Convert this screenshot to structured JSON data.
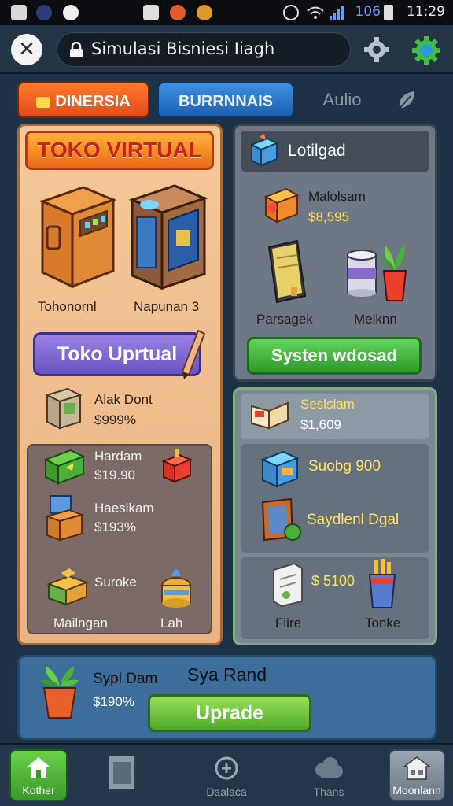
{
  "status_bar": {
    "signal_text": "106",
    "time": "11:29"
  },
  "browser": {
    "url_text": "Simulasi Bisniesi Iiagh"
  },
  "tabs": [
    {
      "label": "DINERSIA"
    },
    {
      "label": "BURRNNAIS"
    },
    {
      "label": "Aulio"
    }
  ],
  "left_panel": {
    "title": "TOKO VIRTUAL",
    "items_top": [
      {
        "label": "Tohonornl"
      },
      {
        "label": "Napunan 3"
      }
    ],
    "primary_button": "Toko Uprtual",
    "featured": {
      "name": "Alak Dont",
      "price": "$999%"
    },
    "list": [
      {
        "name": "Hardam",
        "price": "$19.90"
      },
      {
        "name": "Haeslkam",
        "price": "$193%"
      }
    ],
    "bottom_items": [
      {
        "name": "Suroke",
        "label": "Mailngan"
      },
      {
        "label": "Lah"
      }
    ]
  },
  "right_top": {
    "header": "Lotilgad",
    "item": {
      "name": "Malolsam",
      "price": "$8,595"
    },
    "items": [
      {
        "label": "Parsagek"
      },
      {
        "label": "Melknn"
      }
    ],
    "button": "Systen wdosad"
  },
  "right_bottom": {
    "header": {
      "name": "Seslslam",
      "price": "$1,609"
    },
    "rows": [
      {
        "label": "Suobg 900"
      },
      {
        "label": "Saydlenl Dgal"
      }
    ],
    "items": [
      {
        "price": "$ 5100",
        "label": "Flire"
      },
      {
        "label": "Tonke"
      }
    ]
  },
  "bottom_panel": {
    "item_name": "Sypl Dam",
    "item_price": "$190%",
    "title": "Sya Rand",
    "button": "Uprade"
  },
  "bottom_nav": [
    {
      "label": "Kother"
    },
    {
      "label": ""
    },
    {
      "label": "Daalaca"
    },
    {
      "label": "Thans"
    },
    {
      "label": "Moonlann"
    }
  ],
  "colors": {
    "accent_orange": "#e24b1a",
    "accent_blue": "#1d5fb0",
    "accent_green": "#2c9a2b",
    "accent_purple": "#6a52c2"
  }
}
